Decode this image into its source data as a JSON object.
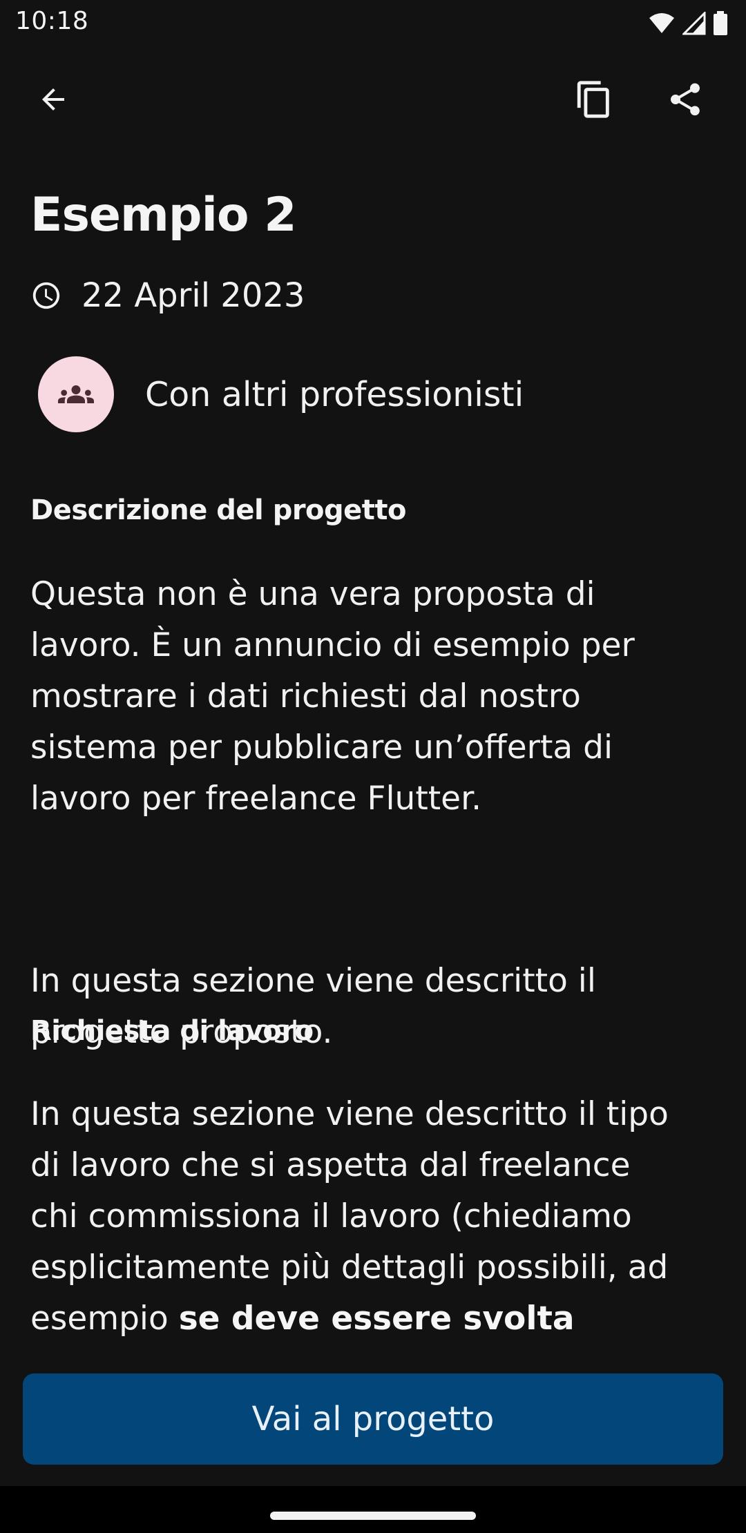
{
  "status_bar": {
    "time": "10:18"
  },
  "app_bar": {
    "back_icon": "arrow-back-icon",
    "copy_icon": "copy-icon",
    "share_icon": "share-icon"
  },
  "project": {
    "title": "Esempio 2",
    "date": "22 April 2023",
    "team_label": "Con altri professionisti",
    "description_heading": "Descrizione del progetto",
    "description_p1": "Questa non è una vera proposta di\nlavoro. È un annuncio di esempio per\nmostrare i dati richiesti dal nostro\nsistema per pubblicare un’offerta di\nlavoro per freelance Flutter.",
    "description_p2": "In questa sezione viene descritto il\nprogetto proposto.",
    "request_heading": "Richiesta di lavoro",
    "request_text": "In questa sezione viene descritto il tipo\ndi lavoro che si aspetta dal freelance\nchi commissiona il lavoro (chiediamo\nesplicitamente più dettagli possibili, ad\nesempio ",
    "request_bold": "se deve essere svolta"
  },
  "cta": {
    "label": "Vai al progetto"
  },
  "colors": {
    "background": "#121212",
    "button": "#03477a",
    "avatar": "#f8d9e2"
  }
}
